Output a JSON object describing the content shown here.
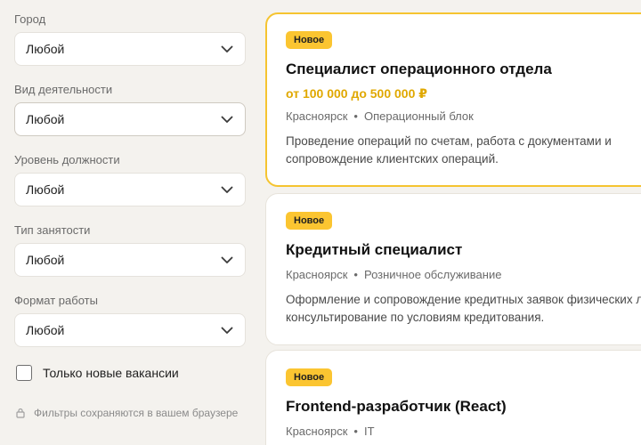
{
  "filters": {
    "city": {
      "label": "Город",
      "value": "Любой"
    },
    "activity": {
      "label": "Вид деятельности",
      "value": "Любой"
    },
    "level": {
      "label": "Уровень должности",
      "value": "Любой"
    },
    "employment": {
      "label": "Тип занятости",
      "value": "Любой"
    },
    "format": {
      "label": "Формат работы",
      "value": "Любой"
    },
    "new_only": {
      "label": "Только новые вакансии",
      "checked": false
    },
    "storage_note": "Фильтры сохраняются в вашем браузере"
  },
  "vacancies": [
    {
      "badge": "Новое",
      "title": "Специалист операционного отдела",
      "salary": "от 100 000 до 500 000 ₽",
      "city": "Красноярск",
      "separator": "•",
      "department": "Операционный блок",
      "desc_line1": "Проведение операций по счетам, работа с документами и",
      "desc_line2": "сопровождение клиентских операций."
    },
    {
      "badge": "Новое",
      "title": "Кредитный специалист",
      "city": "Красноярск",
      "separator": "•",
      "department": "Розничное обслуживание",
      "desc_line1": "Оформление и сопровождение кредитных заявок физических лиц,",
      "desc_line2": "консультирование по условиям кредитования."
    },
    {
      "badge": "Новое",
      "title": "Frontend-разработчик (React)",
      "city": "Красноярск",
      "separator": "•",
      "department": "IT"
    }
  ],
  "icons": {
    "select": "chevron-down-icon",
    "note": "lock-icon"
  },
  "colors": {
    "accent": "#fbc531",
    "salary": "#e0a800",
    "highlight_border": "#f5c430",
    "background": "#f4f2ee"
  }
}
